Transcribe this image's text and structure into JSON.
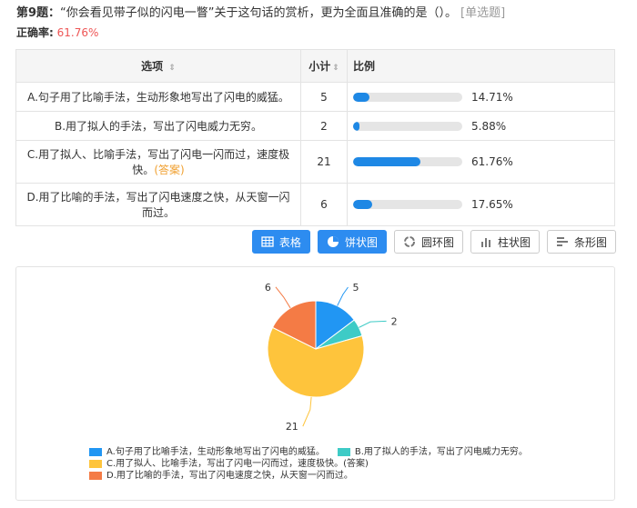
{
  "question": {
    "number": "第9题：",
    "text": "“你会看见带子似的闪电一瞥”关于这句话的赏析，更为全面且准确的是（）。",
    "type_tag": "[单选题]"
  },
  "accuracy": {
    "label": "正确率:",
    "value": "61.76%"
  },
  "table": {
    "headers": {
      "option": "选项",
      "count": "小计",
      "ratio": "比例",
      "sort_glyph": "⇕"
    },
    "rows": [
      {
        "option": "A.句子用了比喻手法，生动形象地写出了闪电的威猛。",
        "answer_tag": "",
        "count": "5",
        "percent": "14.71%",
        "fraction": 0.1471
      },
      {
        "option": "B.用了拟人的手法，写出了闪电威力无穷。",
        "answer_tag": "",
        "count": "2",
        "percent": "5.88%",
        "fraction": 0.0588
      },
      {
        "option": "C.用了拟人、比喻手法，写出了闪电一闪而过，速度极快。",
        "answer_tag": "(答案)",
        "count": "21",
        "percent": "61.76%",
        "fraction": 0.6176
      },
      {
        "option": "D.用了比喻的手法，写出了闪电速度之快，从天窗一闪而过。",
        "answer_tag": "",
        "count": "6",
        "percent": "17.65%",
        "fraction": 0.1765
      }
    ]
  },
  "view_buttons": {
    "table": "表格",
    "pie": "饼状图",
    "ring": "圆环图",
    "column": "柱状图",
    "bar": "条形图"
  },
  "colors": {
    "accent": "#2d8cf0",
    "bar": "#1e88e5",
    "answer": "#f0a030",
    "accuracy": "#ee5555"
  },
  "chart_data": {
    "type": "pie",
    "title": "",
    "categories": [
      "A.句子用了比喻手法，生动形象地写出了闪电的威猛。",
      "B.用了拟人的手法，写出了闪电威力无穷。",
      "C.用了拟人、比喻手法，写出了闪电一闪而过，速度极快。(答案)",
      "D.用了比喻的手法，写出了闪电速度之快，从天窗一闪而过。"
    ],
    "values": [
      5,
      2,
      21,
      6
    ],
    "colors": [
      "#2196f3",
      "#3ecbc6",
      "#fec43c",
      "#f47b45"
    ],
    "legend_position": "bottom"
  }
}
